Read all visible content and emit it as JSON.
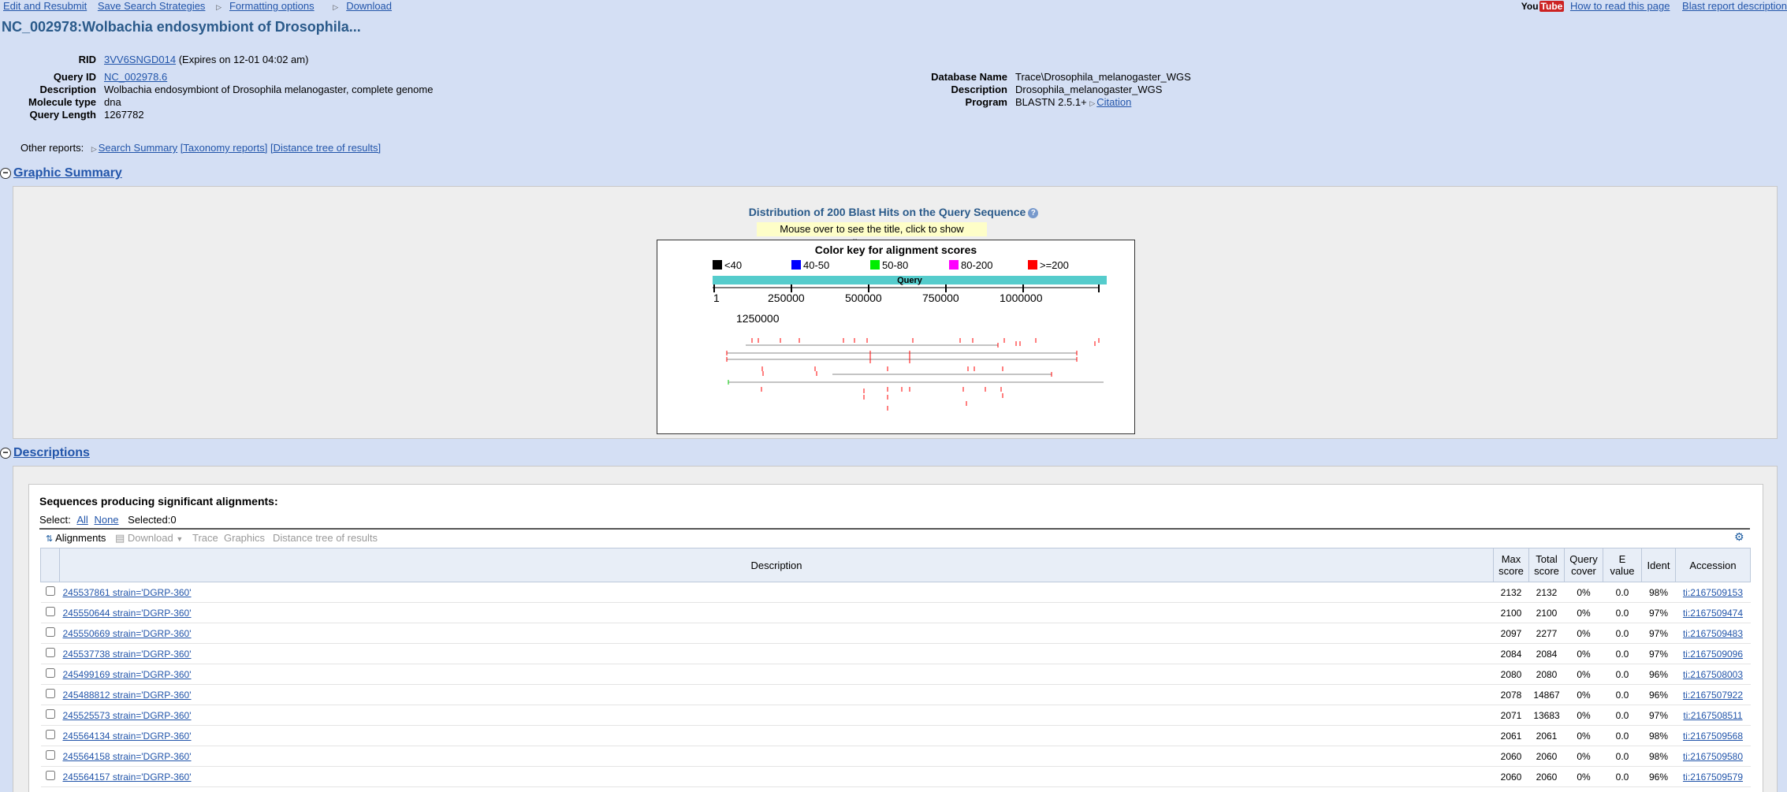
{
  "topnav": {
    "edit_resubmit": "Edit and Resubmit",
    "save_strategies": "Save Search Strategies",
    "formatting": "Formatting options",
    "download": "Download"
  },
  "topright": {
    "youtube_a": "You",
    "youtube_b": "Tube",
    "how_to_read": "How to read this page",
    "blast_report": "Blast report description"
  },
  "title": "NC_002978:Wolbachia endosymbiont of Drosophila...",
  "summary": {
    "rid_label": "RID",
    "rid": "3VV6SNGD014",
    "rid_expires": "(Expires on 12-01 04:02 am)",
    "query_id_label": "Query ID",
    "query_id": "NC_002978.6",
    "description_label": "Description",
    "description": "Wolbachia endosymbiont of Drosophila melanogaster, complete genome",
    "molecule_label": "Molecule type",
    "molecule": "dna",
    "length_label": "Query Length",
    "length": "1267782",
    "db_name_label": "Database Name",
    "db_name": "Trace\\Drosophila_melanogaster_WGS",
    "db_desc_label": "Description",
    "db_desc": "Drosophila_melanogaster_WGS",
    "program_label": "Program",
    "program": "BLASTN 2.5.1+",
    "citation": "Citation"
  },
  "other_reports": {
    "label": "Other reports:",
    "search_summary": "Search Summary",
    "taxonomy": "[Taxonomy reports]",
    "distance": "[Distance tree of results]"
  },
  "graphic_summary": {
    "heading": "Graphic Summary",
    "dist_title": "Distribution of 200 Blast Hits on the Query Sequence",
    "mouse_note": "Mouse over to see the title, click to show alignments",
    "key_title": "Color key for alignment scores",
    "key": [
      {
        "label": "<40",
        "color": "#000000"
      },
      {
        "label": "40-50",
        "color": "#0000ff"
      },
      {
        "label": "50-80",
        "color": "#00ee00"
      },
      {
        "label": "80-200",
        "color": "#ff00ff"
      },
      {
        "label": ">=200",
        "color": "#ff0000"
      }
    ],
    "query_bar_label": "Query",
    "query_bar_color": "#55cccc",
    "ticks": [
      "1",
      "250000",
      "500000",
      "750000",
      "1000000",
      "1250000"
    ]
  },
  "descriptions": {
    "heading": "Descriptions",
    "spa": "Sequences producing significant alignments:",
    "select_label": "Select:",
    "select_all": "All",
    "select_none": "None",
    "selected": "Selected:0",
    "toolbar": {
      "alignments": "Alignments",
      "download": "Download",
      "trace": "Trace",
      "graphics": "Graphics",
      "distance": "Distance tree of results"
    },
    "columns": {
      "description": "Description",
      "max_a": "Max",
      "max_b": "score",
      "total_a": "Total",
      "total_b": "score",
      "qc_a": "Query",
      "qc_b": "cover",
      "e_a": "E",
      "e_b": "value",
      "ident": "Ident",
      "accession": "Accession"
    },
    "rows": [
      {
        "desc": "245537861 strain='DGRP-360'",
        "max": "2132",
        "total": "2132",
        "qc": "0%",
        "e": "0.0",
        "ident": "98%",
        "acc": "ti:2167509153"
      },
      {
        "desc": "245550644 strain='DGRP-360'",
        "max": "2100",
        "total": "2100",
        "qc": "0%",
        "e": "0.0",
        "ident": "97%",
        "acc": "ti:2167509474"
      },
      {
        "desc": "245550669 strain='DGRP-360'",
        "max": "2097",
        "total": "2277",
        "qc": "0%",
        "e": "0.0",
        "ident": "97%",
        "acc": "ti:2167509483"
      },
      {
        "desc": "245537738 strain='DGRP-360'",
        "max": "2084",
        "total": "2084",
        "qc": "0%",
        "e": "0.0",
        "ident": "97%",
        "acc": "ti:2167509096"
      },
      {
        "desc": "245499169 strain='DGRP-360'",
        "max": "2080",
        "total": "2080",
        "qc": "0%",
        "e": "0.0",
        "ident": "96%",
        "acc": "ti:2167508003"
      },
      {
        "desc": "245488812 strain='DGRP-360'",
        "max": "2078",
        "total": "14867",
        "qc": "0%",
        "e": "0.0",
        "ident": "96%",
        "acc": "ti:2167507922"
      },
      {
        "desc": "245525573 strain='DGRP-360'",
        "max": "2071",
        "total": "13683",
        "qc": "0%",
        "e": "0.0",
        "ident": "97%",
        "acc": "ti:2167508511"
      },
      {
        "desc": "245564134 strain='DGRP-360'",
        "max": "2061",
        "total": "2061",
        "qc": "0%",
        "e": "0.0",
        "ident": "98%",
        "acc": "ti:2167509568"
      },
      {
        "desc": "245564158 strain='DGRP-360'",
        "max": "2060",
        "total": "2060",
        "qc": "0%",
        "e": "0.0",
        "ident": "98%",
        "acc": "ti:2167509580"
      },
      {
        "desc": "245564157 strain='DGRP-360'",
        "max": "2060",
        "total": "2060",
        "qc": "0%",
        "e": "0.0",
        "ident": "96%",
        "acc": "ti:2167509579"
      }
    ]
  }
}
